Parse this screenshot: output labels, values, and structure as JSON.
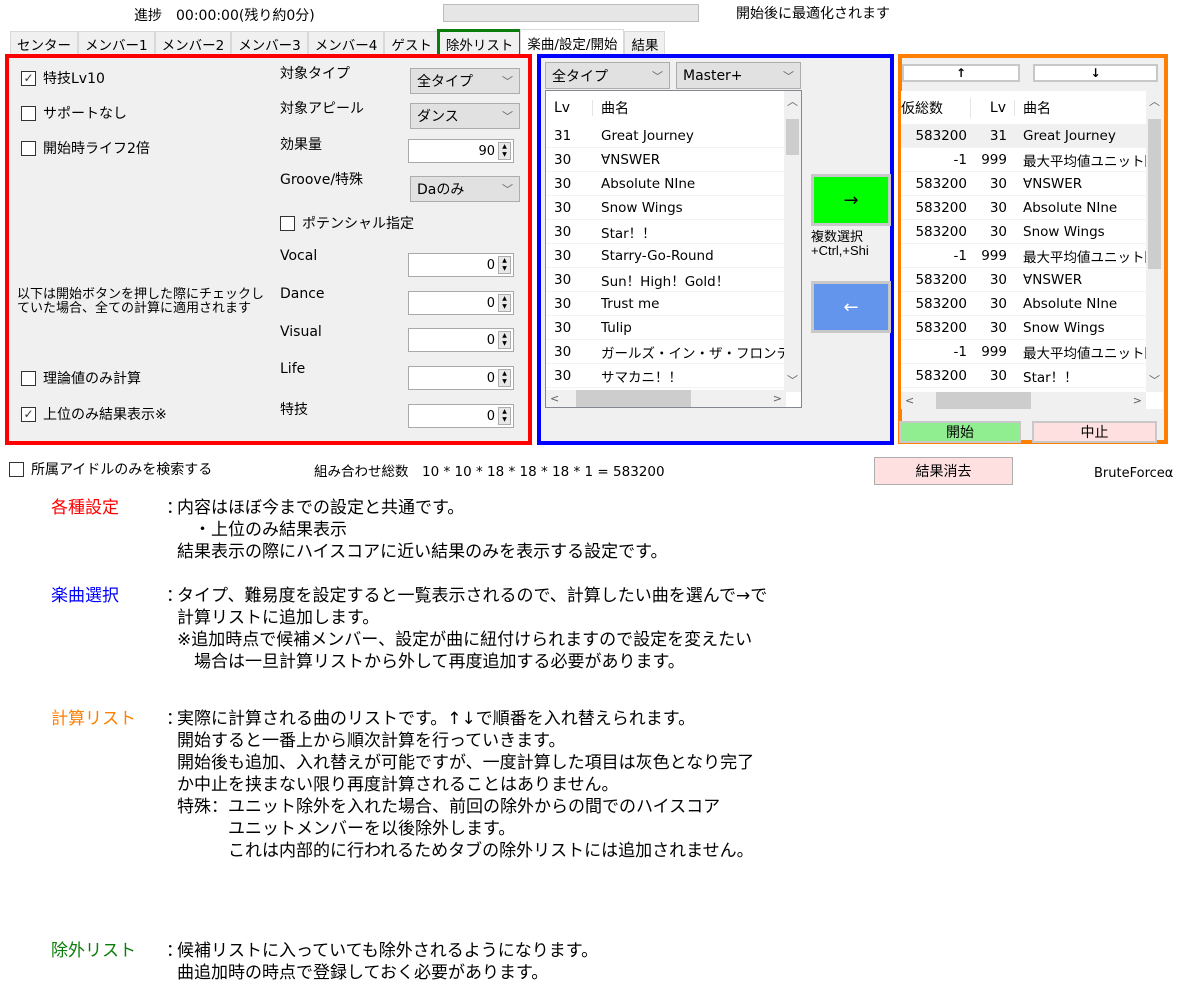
{
  "header": {
    "progress_label": "進捗　00:00:00(残り約0分)",
    "progress_value": 0,
    "progress_hint": "開始後に最適化されます"
  },
  "tabs": [
    {
      "label": "センター"
    },
    {
      "label": "メンバー1"
    },
    {
      "label": "メンバー2"
    },
    {
      "label": "メンバー3"
    },
    {
      "label": "メンバー4"
    },
    {
      "label": "ゲスト"
    },
    {
      "label": "除外リスト"
    },
    {
      "label": "楽曲/設定/開始",
      "active": true
    },
    {
      "label": "結果"
    }
  ],
  "settings": {
    "checkboxes": [
      {
        "label": "特技Lv10",
        "checked": true
      },
      {
        "label": "サポートなし",
        "checked": false
      },
      {
        "label": "開始時ライフ2倍",
        "checked": false
      }
    ],
    "target_type_label": "対象タイプ",
    "target_type_value": "全タイプ",
    "target_appeal_label": "対象アピール",
    "target_appeal_value": "ダンス",
    "effect_label": "効果量",
    "effect_value": "90",
    "groove_label": "Groove/特殊",
    "groove_value": "Daのみ",
    "potential_label": "ポテンシャル指定",
    "potential_checked": false,
    "potentials": [
      {
        "label": "Vocal",
        "value": "0"
      },
      {
        "label": "Dance",
        "value": "0"
      },
      {
        "label": "Visual",
        "value": "0"
      },
      {
        "label": "Life",
        "value": "0"
      },
      {
        "label": "特技",
        "value": "0"
      }
    ],
    "note": "以下は開始ボタンを押した際にチェックしていた場合、全ての計算に適用されます",
    "theory_only_label": "理論値のみ計算",
    "theory_only_checked": false,
    "top_only_label": "上位のみ結果表示※",
    "top_only_checked": true
  },
  "song_select": {
    "type_value": "全タイプ",
    "difficulty_value": "Master+",
    "col_lv": "Lv",
    "col_name": "曲名",
    "rows": [
      {
        "lv": "31",
        "name": "Great Journey"
      },
      {
        "lv": "30",
        "name": "∀NSWER"
      },
      {
        "lv": "30",
        "name": "Absolute NIne"
      },
      {
        "lv": "30",
        "name": "Snow Wings"
      },
      {
        "lv": "30",
        "name": "Star！！"
      },
      {
        "lv": "30",
        "name": "Starry-Go-Round"
      },
      {
        "lv": "30",
        "name": "Sun！High！Gold！"
      },
      {
        "lv": "30",
        "name": "Trust me"
      },
      {
        "lv": "30",
        "name": "Tulip"
      },
      {
        "lv": "30",
        "name": "ガールズ・イン・ザ・フロンティア"
      },
      {
        "lv": "30",
        "name": "サマカニ！！"
      }
    ],
    "add_button": "→",
    "remove_button": "←",
    "multi_hint_line1": "複数選択",
    "multi_hint_line2": "+Ctrl,+Shi"
  },
  "calc_list": {
    "up_button": "↑",
    "down_button": "↓",
    "col_total": "仮総数",
    "col_lv": "Lv",
    "col_name": "曲名",
    "rows": [
      {
        "total": "583200",
        "lv": "31",
        "name": "Great Journey"
      },
      {
        "total": "-1",
        "lv": "999",
        "name": "最大平均値ユニット除外"
      },
      {
        "total": "583200",
        "lv": "30",
        "name": "∀NSWER"
      },
      {
        "total": "583200",
        "lv": "30",
        "name": "Absolute NIne"
      },
      {
        "total": "583200",
        "lv": "30",
        "name": "Snow Wings"
      },
      {
        "total": "-1",
        "lv": "999",
        "name": "最大平均値ユニット除外"
      },
      {
        "total": "583200",
        "lv": "30",
        "name": "∀NSWER"
      },
      {
        "total": "583200",
        "lv": "30",
        "name": "Absolute NIne"
      },
      {
        "total": "583200",
        "lv": "30",
        "name": "Snow Wings"
      },
      {
        "total": "-1",
        "lv": "999",
        "name": "最大平均値ユニット除外"
      },
      {
        "total": "583200",
        "lv": "30",
        "name": "Star！！"
      }
    ],
    "start_button": "開始",
    "stop_button": "中止"
  },
  "footer": {
    "own_idol_label": "所属アイドルのみを検索する",
    "own_idol_checked": false,
    "combo_label": "組み合わせ総数　10 * 10 * 18 * 18 * 18 * 1 = 583200",
    "clear_button": "結果消去",
    "brand": "BruteForceα"
  },
  "description": {
    "colors": {
      "settings": "#ff0000",
      "songs": "#0000ff",
      "calc": "#ff7f00",
      "exclude": "#0a7d0a"
    },
    "sections": [
      {
        "head": "各種設定",
        "lines": [
          "内容はほぼ今までの設定と共通です。",
          "　・上位のみ結果表示",
          "結果表示の際にハイスコアに近い結果のみを表示する設定です。"
        ]
      },
      {
        "head": "楽曲選択",
        "lines": [
          "タイプ、難易度を設定すると一覧表示されるので、計算したい曲を選んで→で",
          "計算リストに追加します。",
          "※追加時点で候補メンバー、設定が曲に紐付けられますので設定を変えたい",
          "　場合は一旦計算リストから外して再度追加する必要があります。"
        ]
      },
      {
        "head": "計算リスト",
        "lines": [
          "実際に計算される曲のリストです。↑↓で順番を入れ替えられます。",
          "開始すると一番上から順次計算を行っていきます。",
          "開始後も追加、入れ替えが可能ですが、一度計算した項目は灰色となり完了",
          "か中止を挟まない限り再度計算されることはありません。",
          "特殊：ユニット除外を入れた場合、前回の除外からの間でのハイスコア",
          "　　　ユニットメンバーを以後除外します。",
          "　　　これは内部的に行われるためタブの除外リストには追加されません。"
        ]
      },
      {
        "head": "除外リスト",
        "lines": [
          "候補リストに入っていても除外されるようになります。",
          "曲追加時の時点で登録しておく必要があります。"
        ]
      }
    ],
    "separator": "："
  }
}
